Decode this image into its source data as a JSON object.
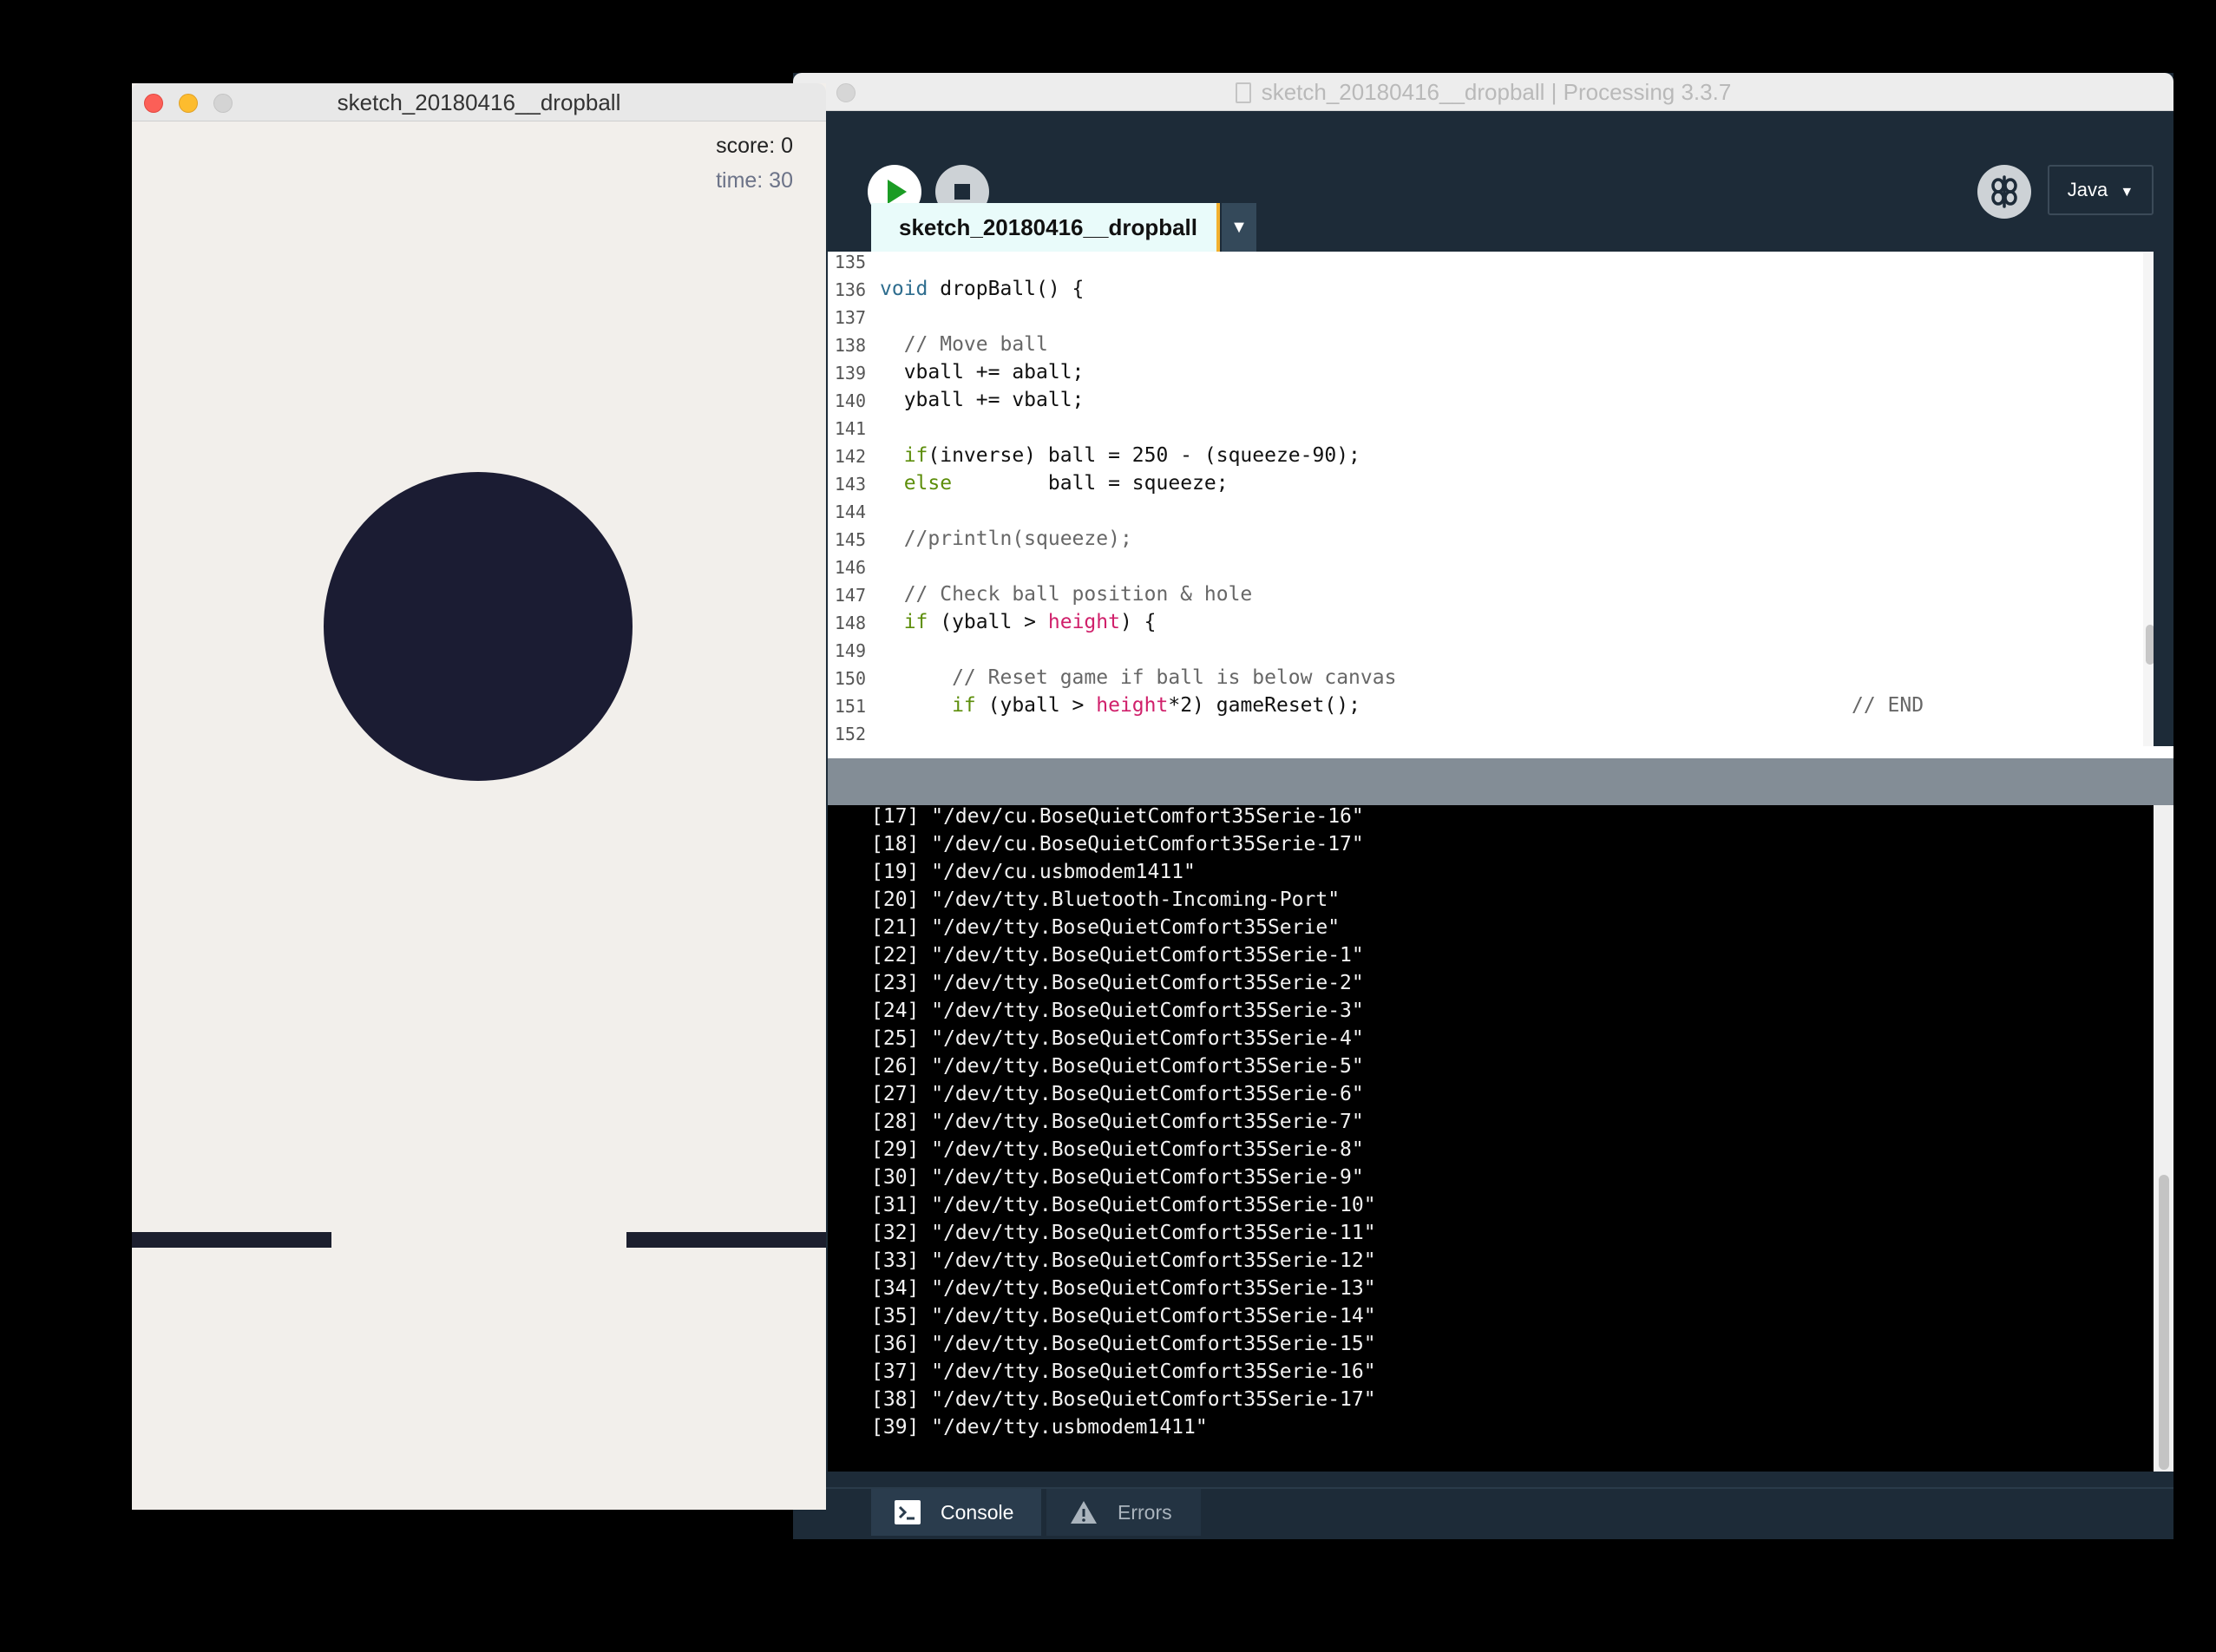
{
  "ide": {
    "title": "sketch_20180416__dropball | Processing 3.3.7",
    "mode": "Java",
    "mode_arrow": "▼",
    "tab_label": "sketch_20180416__dropball",
    "tab_menu_arrow": "▼",
    "run_icon": "play-icon",
    "stop_icon": "stop-icon",
    "debug_icon": "debugger-icon"
  },
  "editor": {
    "line_numbers": [
      "135",
      "136",
      "137",
      "138",
      "139",
      "140",
      "141",
      "142",
      "143",
      "144",
      "145",
      "146",
      "147",
      "148",
      "149",
      "150",
      "151",
      "152"
    ],
    "code": {
      "l136_a": "void",
      "l136_b": " dropBall() {",
      "l138": "  // Move ball",
      "l139": "  vball += aball;",
      "l140": "  yball += vball;",
      "l142_a": "  if",
      "l142_b": "(inverse) ball = 250 - (squeeze-90);",
      "l143_a": "  else",
      "l143_b": "        ball = squeeze;",
      "l145": "  //println(squeeze);",
      "l147": "  // Check ball position & hole",
      "l148_a": "  if",
      "l148_b": " (yball > ",
      "l148_c": "height",
      "l148_d": ") {",
      "l150": "      // Reset game if ball is below canvas",
      "l151_a": "      if",
      "l151_b": " (yball > ",
      "l151_c": "height",
      "l151_d": "*2) gameReset();",
      "l151_e": "// END"
    }
  },
  "console": {
    "lines": [
      "[17] \"/dev/cu.BoseQuietComfort35Serie-16\"",
      "[18] \"/dev/cu.BoseQuietComfort35Serie-17\"",
      "[19] \"/dev/cu.usbmodem1411\"",
      "[20] \"/dev/tty.Bluetooth-Incoming-Port\"",
      "[21] \"/dev/tty.BoseQuietComfort35Serie\"",
      "[22] \"/dev/tty.BoseQuietComfort35Serie-1\"",
      "[23] \"/dev/tty.BoseQuietComfort35Serie-2\"",
      "[24] \"/dev/tty.BoseQuietComfort35Serie-3\"",
      "[25] \"/dev/tty.BoseQuietComfort35Serie-4\"",
      "[26] \"/dev/tty.BoseQuietComfort35Serie-5\"",
      "[27] \"/dev/tty.BoseQuietComfort35Serie-6\"",
      "[28] \"/dev/tty.BoseQuietComfort35Serie-7\"",
      "[29] \"/dev/tty.BoseQuietComfort35Serie-8\"",
      "[30] \"/dev/tty.BoseQuietComfort35Serie-9\"",
      "[31] \"/dev/tty.BoseQuietComfort35Serie-10\"",
      "[32] \"/dev/tty.BoseQuietComfort35Serie-11\"",
      "[33] \"/dev/tty.BoseQuietComfort35Serie-12\"",
      "[34] \"/dev/tty.BoseQuietComfort35Serie-13\"",
      "[35] \"/dev/tty.BoseQuietComfort35Serie-14\"",
      "[36] \"/dev/tty.BoseQuietComfort35Serie-15\"",
      "[37] \"/dev/tty.BoseQuietComfort35Serie-16\"",
      "[38] \"/dev/tty.BoseQuietComfort35Serie-17\"",
      "[39] \"/dev/tty.usbmodem1411\""
    ],
    "tabs": {
      "console_label": "Console",
      "console_icon": "terminal-icon",
      "errors_label": "Errors",
      "errors_icon": "warning-icon"
    }
  },
  "sketch": {
    "title": "sketch_20180416__dropball",
    "score": "score: 0",
    "time": "time: 30"
  },
  "colors": {
    "ide_background": "#1d2b38",
    "tab_active": "#e9fbfa",
    "tab_accent": "#f2b02e",
    "run_green": "#1b9c24",
    "keyword": "#5d8e0b",
    "builtin": "#d0206b",
    "ball": "#1b1c33",
    "sketch_background": "#f2efeb"
  }
}
